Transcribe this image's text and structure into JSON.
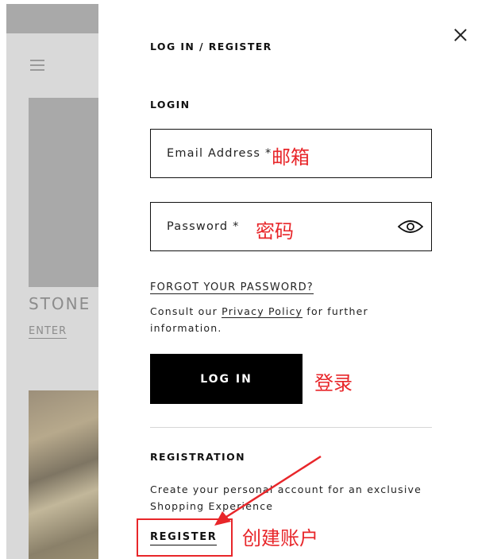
{
  "background": {
    "brand_partial": "STONE I",
    "enter_label": "ENTER"
  },
  "modal": {
    "title": "LOG IN / REGISTER",
    "login_section": "LOGIN",
    "email_placeholder": "Email Address *",
    "password_placeholder": "Password *",
    "forgot_password": "FORGOT YOUR PASSWORD?",
    "consult_prefix": "Consult our ",
    "privacy_policy": "Privacy Policy",
    "consult_suffix": " for further",
    "consult_line2": "information.",
    "login_button": "LOG IN",
    "registration_section": "REGISTRATION",
    "registration_text_line1": "Create your personal account for an exclusive",
    "registration_text_line2": "Shopping Experience",
    "register_button": "REGISTER"
  },
  "annotations": {
    "email": "邮箱",
    "password": "密码",
    "login": "登录",
    "register": "创建账户",
    "color": "#e8262a"
  },
  "icons": {
    "close": "close-icon",
    "eye": "eye-icon",
    "menu": "hamburger-menu-icon"
  }
}
